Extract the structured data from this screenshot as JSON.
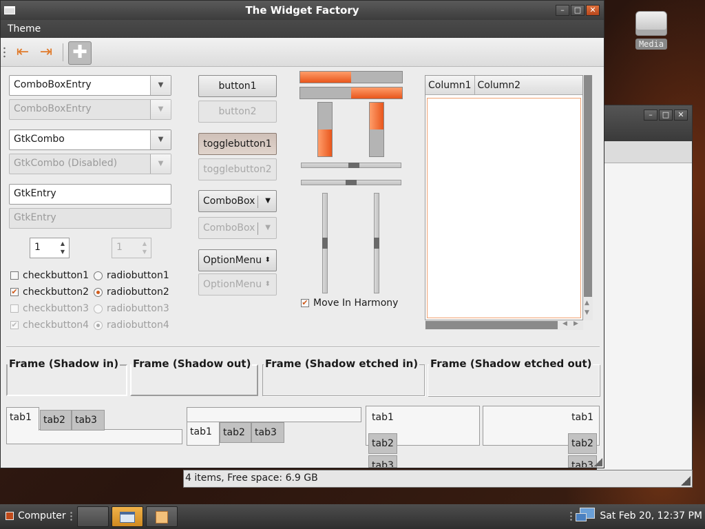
{
  "window": {
    "title": "The Widget Factory",
    "menu": [
      "Theme"
    ]
  },
  "toolbar": {
    "buttons": [
      "go-first-icon",
      "go-last-icon",
      "add-icon"
    ]
  },
  "entries": {
    "combo_entry": "ComboBoxEntry",
    "combo_entry_disabled": "ComboBoxEntry",
    "gtk_combo": "GtkCombo",
    "gtk_combo_disabled": "GtkCombo (Disabled)",
    "entry": "GtkEntry",
    "entry_disabled": "GtkEntry",
    "spin": "1",
    "spin_disabled": "1"
  },
  "checks": [
    {
      "label": "checkbutton1",
      "checked": false,
      "enabled": true
    },
    {
      "label": "checkbutton2",
      "checked": true,
      "enabled": true
    },
    {
      "label": "checkbutton3",
      "checked": false,
      "enabled": false
    },
    {
      "label": "checkbutton4",
      "checked": true,
      "enabled": false
    }
  ],
  "radios": [
    {
      "label": "radiobutton1",
      "checked": false,
      "enabled": true
    },
    {
      "label": "radiobutton2",
      "checked": true,
      "enabled": true
    },
    {
      "label": "radiobutton3",
      "checked": false,
      "enabled": false
    },
    {
      "label": "radiobutton4",
      "checked": true,
      "enabled": false
    }
  ],
  "buttons": {
    "button1": "button1",
    "button2": "button2",
    "toggle1": "togglebutton1",
    "toggle2": "togglebutton2",
    "combobox": "ComboBox",
    "combobox_disabled": "ComboBox",
    "optionmenu": "OptionMenu",
    "optionmenu_disabled": "OptionMenu"
  },
  "progress": {
    "h1": 0.5,
    "h2": 0.5,
    "v1": 0.5,
    "v2": 0.5
  },
  "scales": {
    "h1": 0.53,
    "h2": 0.5,
    "v1": 0.5,
    "v2": 0.5
  },
  "move_in_harmony": {
    "label": "Move In Harmony",
    "checked": true
  },
  "tree": {
    "columns": [
      "Column1",
      "Column2"
    ]
  },
  "frames": [
    "Frame (Shadow in)",
    "Frame (Shadow out)",
    "Frame (Shadow etched in)",
    "Frame (Shadow etched out)"
  ],
  "notebooks": {
    "tabs": [
      "tab1",
      "tab2",
      "tab3"
    ]
  },
  "filemgr_status": "4 items, Free space: 6.9 GB",
  "desktop": {
    "media_label": "Media"
  },
  "taskbar": {
    "start_label": "Computer",
    "clock": "Sat Feb 20, 12:37 PM"
  },
  "colors": {
    "accent": "#e8561c",
    "titlebar": "#3c3c3c",
    "close_button": "#c0501f"
  }
}
